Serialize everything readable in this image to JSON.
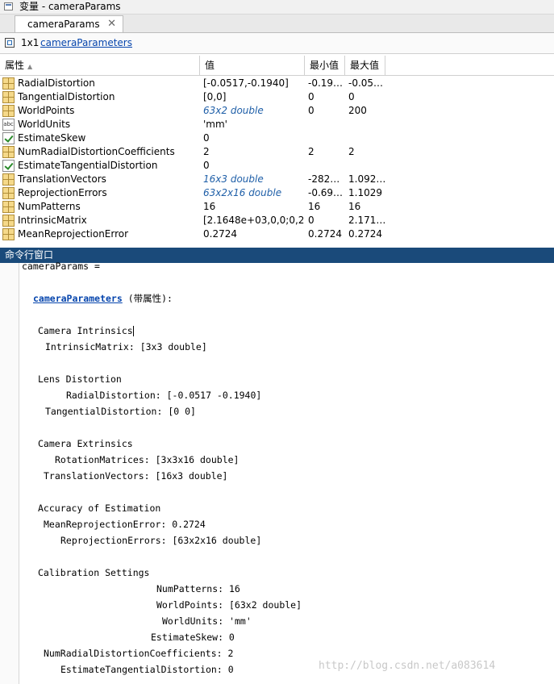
{
  "window": {
    "title": "变量 - cameraParams"
  },
  "tab": {
    "label": "cameraParams",
    "close": "✕"
  },
  "info": {
    "dims": "1x1",
    "class_link": "cameraParameters"
  },
  "table": {
    "headers": {
      "name": "属性",
      "value": "值",
      "min": "最小值",
      "max": "最大值"
    },
    "rows": [
      {
        "icon": "grid-icon",
        "name": "RadialDistortion",
        "value": "[-0.0517,-0.1940]",
        "min": "-0.19…",
        "max": "-0.05…",
        "italic": false
      },
      {
        "icon": "grid-icon",
        "name": "TangentialDistortion",
        "value": "[0,0]",
        "min": "0",
        "max": "0",
        "italic": false
      },
      {
        "icon": "grid-icon",
        "name": "WorldPoints",
        "value": "63x2 double",
        "min": "0",
        "max": "200",
        "italic": true
      },
      {
        "icon": "text-icon",
        "name": "WorldUnits",
        "value": "'mm'",
        "min": "",
        "max": "",
        "italic": false
      },
      {
        "icon": "checkbox-icon",
        "name": "EstimateSkew",
        "value": "0",
        "min": "",
        "max": "",
        "italic": false
      },
      {
        "icon": "grid-icon",
        "name": "NumRadialDistortionCoefficients",
        "value": "2",
        "min": "2",
        "max": "2",
        "italic": false
      },
      {
        "icon": "checkbox-icon",
        "name": "EstimateTangentialDistortion",
        "value": "0",
        "min": "",
        "max": "",
        "italic": false
      },
      {
        "icon": "grid-icon",
        "name": "TranslationVectors",
        "value": "16x3 double",
        "min": "-282…",
        "max": "1.092…",
        "italic": true
      },
      {
        "icon": "grid-icon",
        "name": "ReprojectionErrors",
        "value": "63x2x16 double",
        "min": "-0.69…",
        "max": "1.1029",
        "italic": true
      },
      {
        "icon": "grid-icon",
        "name": "NumPatterns",
        "value": "16",
        "min": "16",
        "max": "16",
        "italic": false
      },
      {
        "icon": "grid-icon",
        "name": "IntrinsicMatrix",
        "value": "[2.1648e+03,0,0;0,2…",
        "min": "0",
        "max": "2.171…",
        "italic": false
      },
      {
        "icon": "grid-icon",
        "name": "MeanReprojectionError",
        "value": "0.2724",
        "min": "0.2724",
        "max": "0.2724",
        "italic": false
      }
    ]
  },
  "command_window": {
    "title": "命令行窗口",
    "var_line": "cameraParams =",
    "class_link": "cameraParameters",
    "class_suffix": " (带属性):",
    "sections": {
      "intrinsics": {
        "heading": "Camera Intrinsics",
        "l1": "IntrinsicMatrix: [3x3 double]"
      },
      "lens": {
        "heading": "Lens Distortion",
        "l1": "RadialDistortion: [-0.0517 -0.1940]",
        "l2": "TangentialDistortion: [0 0]"
      },
      "extrinsics": {
        "heading": "Camera Extrinsics",
        "l1": "RotationMatrices: [3x3x16 double]",
        "l2": "TranslationVectors: [16x3 double]"
      },
      "accuracy": {
        "heading": "Accuracy of Estimation",
        "l1": "MeanReprojectionError: 0.2724",
        "l2": "ReprojectionErrors: [63x2x16 double]"
      },
      "calibration": {
        "heading": "Calibration Settings",
        "l1": "NumPatterns: 16",
        "l2": "WorldPoints: [63x2 double]",
        "l3": "WorldUnits: 'mm'",
        "l4": "EstimateSkew: 0",
        "l5": "NumRadialDistortionCoefficients: 2",
        "l6": "EstimateTangentialDistortion: 0"
      }
    }
  },
  "watermark": "http://blog.csdn.net/a083614"
}
